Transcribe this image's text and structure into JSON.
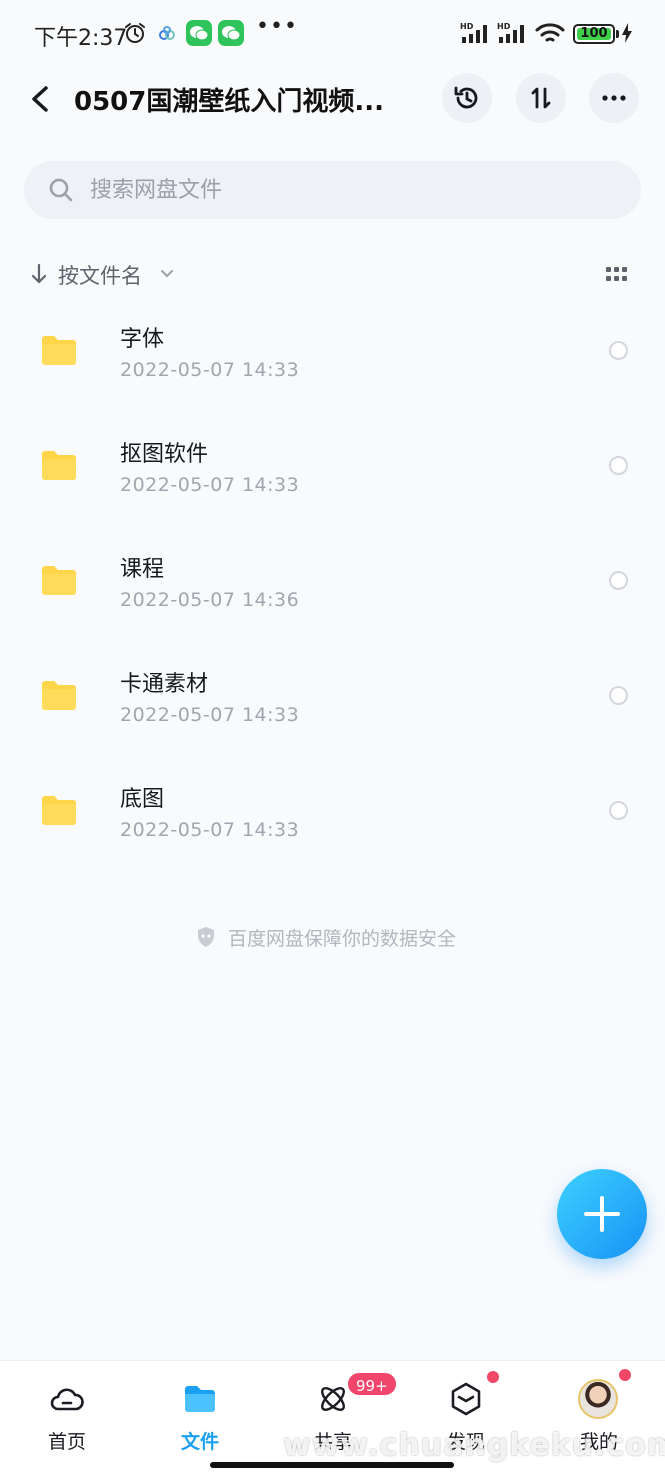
{
  "status_bar": {
    "time": "下午2:37",
    "battery": "100",
    "battery_level": 1.0
  },
  "header": {
    "title": "0507国潮壁纸入门视频..."
  },
  "search": {
    "placeholder": "搜索网盘文件"
  },
  "sort": {
    "label": "按文件名"
  },
  "files": [
    {
      "name": "字体",
      "date": "2022-05-07  14:33"
    },
    {
      "name": "抠图软件",
      "date": "2022-05-07  14:33"
    },
    {
      "name": "课程",
      "date": "2022-05-07  14:36"
    },
    {
      "name": "卡通素材",
      "date": "2022-05-07  14:33"
    },
    {
      "name": "底图",
      "date": "2022-05-07  14:33"
    }
  ],
  "footer_note": "百度网盘保障你的数据安全",
  "nav": {
    "home": "首页",
    "files": "文件",
    "share": "共享",
    "share_badge": "99+",
    "discover": "发现",
    "mine": "我的"
  },
  "watermark": "www.chuangkeku.com",
  "colors": {
    "accent": "#1aa0f3",
    "folder": "#ffd54a",
    "badge": "#f2456b",
    "background": "#f9fafc"
  },
  "icons": {
    "back": "chevron-left-icon",
    "history": "history-icon",
    "sort": "sort-icon",
    "more": "more-icon",
    "search": "search-icon",
    "grid": "grid-icon",
    "folder": "folder-icon",
    "add": "plus-icon"
  }
}
